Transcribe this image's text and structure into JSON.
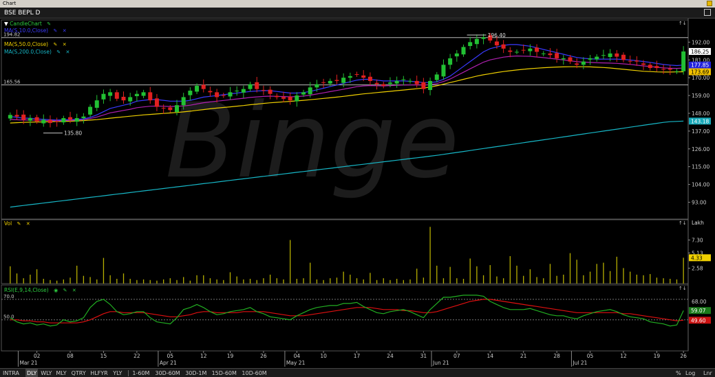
{
  "window": {
    "title": "Chart"
  },
  "symbol": "BSE BEPL D",
  "watermark": "Binge",
  "price_panel": {
    "legends": [
      {
        "label": "CandleChart",
        "color": "#2ecc40"
      },
      {
        "label": "MA(S,10.0,Close)",
        "color": "#3a3aff"
      },
      {
        "label": "MA(S,50.0,Close)",
        "color": "#f0d000"
      },
      {
        "label": "MA(S,200.0,Close)",
        "color": "#17b8c8"
      }
    ],
    "ref_lines": [
      {
        "label": "194.82",
        "value": 194.82
      },
      {
        "label": "165.56",
        "value": 165.56
      }
    ],
    "annotations": [
      {
        "label": "196.40",
        "value": 196.4
      },
      {
        "label": "135.80",
        "value": 135.8
      }
    ],
    "y_ticks": [
      "192.00",
      "181.00",
      "170.00",
      "159.00",
      "148.00",
      "137.00",
      "126.00",
      "115.00",
      "104.00",
      "93.00"
    ],
    "price_badges": [
      {
        "label": "186.25",
        "value": 186.25,
        "bg": "#ffffff",
        "fg": "#000000"
      },
      {
        "label": "177.85",
        "value": 177.85,
        "bg": "#2222dd",
        "fg": "#ffffff"
      },
      {
        "label": "173.69",
        "value": 173.69,
        "bg": "#f0c000",
        "fg": "#000000"
      },
      {
        "label": "143.18",
        "value": 143.18,
        "bg": "#17a8b8",
        "fg": "#ffffff"
      }
    ]
  },
  "vol_panel": {
    "label": "Vol",
    "unit": "Lakh",
    "y_ticks": [
      "7.30",
      "5.13",
      "2.58"
    ],
    "badge": "4.33"
  },
  "rsi_panel": {
    "label": "RSI(E,9,14,Close)",
    "levels": [
      "70.0",
      "50.0"
    ],
    "y_ticks": [
      "68.00"
    ],
    "badges": [
      {
        "label": "59.07",
        "value": 59.07,
        "bg": "#1a7a1a"
      },
      {
        "label": "49.60",
        "value": 49.6,
        "bg": "#cc1111"
      }
    ]
  },
  "x_axis": {
    "day_labels": [
      {
        "t": "02",
        "i": 4
      },
      {
        "t": "08",
        "i": 9
      },
      {
        "t": "15",
        "i": 14
      },
      {
        "t": "22",
        "i": 19
      },
      {
        "t": "05",
        "i": 24
      },
      {
        "t": "12",
        "i": 29
      },
      {
        "t": "19",
        "i": 33
      },
      {
        "t": "26",
        "i": 38
      },
      {
        "t": "04",
        "i": 43
      },
      {
        "t": "10",
        "i": 47
      },
      {
        "t": "17",
        "i": 52
      },
      {
        "t": "24",
        "i": 57
      },
      {
        "t": "31",
        "i": 62
      },
      {
        "t": "07",
        "i": 67
      },
      {
        "t": "14",
        "i": 72
      },
      {
        "t": "21",
        "i": 77
      },
      {
        "t": "28",
        "i": 82
      },
      {
        "t": "05",
        "i": 87
      },
      {
        "t": "12",
        "i": 92
      },
      {
        "t": "19",
        "i": 97
      },
      {
        "t": "26",
        "i": 101
      }
    ],
    "month_labels": [
      {
        "t": "Mar 21",
        "i": 2
      },
      {
        "t": "Apr 21",
        "i": 23
      },
      {
        "t": "May 21",
        "i": 42
      },
      {
        "t": "Jun 21",
        "i": 64
      },
      {
        "t": "Jul 21",
        "i": 85
      }
    ]
  },
  "bottom_bar": {
    "timeframes": [
      "INTRA",
      "DLY",
      "WLY",
      "MLY",
      "QTRY",
      "HLFYR",
      "YLY"
    ],
    "active": "DLY",
    "intraday": [
      "1-60M",
      "30D-60M",
      "30D-1M",
      "15D-60M",
      "10D-60M"
    ],
    "right": [
      "%",
      "Log",
      "Lnr"
    ]
  },
  "chart_data": {
    "type": "candlestick",
    "bars": 102,
    "price_range": [
      86,
      196.4
    ],
    "closes": [
      147,
      146,
      144,
      145,
      143,
      144,
      142,
      143,
      145,
      144,
      145,
      146,
      152,
      156,
      160,
      161,
      157,
      156,
      158,
      160,
      161,
      156,
      152,
      151,
      150,
      153,
      158,
      162,
      165,
      163,
      161,
      158,
      159,
      161,
      162,
      163,
      166,
      163,
      162,
      160,
      158,
      157,
      156,
      159,
      161,
      164,
      166,
      167,
      168,
      168,
      170,
      171,
      172,
      170,
      168,
      166,
      165,
      167,
      168,
      169,
      168,
      166,
      163,
      168,
      172,
      178,
      182,
      185,
      189,
      192,
      194,
      195,
      193,
      190,
      188,
      186,
      186,
      187,
      188,
      186,
      185,
      184,
      182,
      182,
      180,
      178,
      180,
      182,
      183,
      184,
      185,
      183,
      181,
      180,
      180,
      178,
      176,
      176,
      175,
      175,
      174,
      186.25
    ],
    "volume": [
      2.9,
      1.7,
      0.9,
      1.5,
      2.4,
      0.8,
      0.6,
      0.5,
      0.7,
      1.0,
      3.0,
      1.3,
      1.1,
      0.7,
      4.3,
      1.4,
      0.8,
      1.7,
      0.8,
      0.6,
      0.7,
      0.6,
      0.5,
      0.7,
      0.9,
      0.6,
      1.1,
      0.5,
      1.4,
      1.4,
      0.9,
      0.7,
      0.6,
      1.9,
      1.2,
      0.7,
      0.8,
      0.6,
      0.9,
      1.5,
      0.9,
      0.7,
      7.3,
      0.8,
      0.9,
      3.5,
      0.7,
      0.6,
      0.9,
      1.0,
      2.0,
      1.5,
      0.9,
      0.7,
      1.8,
      0.6,
      0.9,
      0.6,
      0.8,
      0.6,
      0.7,
      2.5,
      1.0,
      9.5,
      3.0,
      0.9,
      2.8,
      0.9,
      0.8,
      4.2,
      2.9,
      1.4,
      3.1,
      1.2,
      0.9,
      4.6,
      3.0,
      1.3,
      2.4,
      1.1,
      0.9,
      3.3,
      1.3,
      1.5,
      5.1,
      4.0,
      1.4,
      2.0,
      3.3,
      3.5,
      2.1,
      4.5,
      2.6,
      2.0,
      1.5,
      1.4,
      1.6,
      1.0,
      0.9,
      0.8,
      0.7,
      4.33
    ],
    "rsi": [
      52,
      48,
      46,
      47,
      45,
      46,
      44,
      45,
      50,
      48,
      49,
      52,
      62,
      68,
      70,
      65,
      58,
      55,
      56,
      58,
      58,
      52,
      48,
      47,
      46,
      52,
      60,
      62,
      65,
      62,
      58,
      55,
      56,
      58,
      59,
      60,
      62,
      58,
      56,
      53,
      52,
      51,
      50,
      54,
      57,
      60,
      62,
      63,
      64,
      64,
      66,
      66,
      67,
      63,
      60,
      57,
      56,
      58,
      59,
      60,
      58,
      55,
      52,
      60,
      66,
      72,
      72,
      73,
      74,
      74,
      74,
      73,
      68,
      65,
      62,
      60,
      60,
      60,
      61,
      59,
      57,
      55,
      54,
      54,
      52,
      51,
      54,
      56,
      58,
      59,
      60,
      58,
      55,
      53,
      52,
      51,
      48,
      47,
      46,
      44,
      45,
      59.07
    ],
    "ma10": [
      146,
      145.5,
      145,
      145,
      144.5,
      144.3,
      144,
      143.8,
      144,
      144.1,
      144.2,
      144.5,
      145.5,
      147,
      149,
      151,
      152,
      153,
      154,
      155.5,
      156,
      156.5,
      156.5,
      156,
      155.5,
      155.5,
      155.5,
      156,
      157,
      158,
      158.5,
      159,
      159.5,
      160,
      160.5,
      161,
      161.5,
      161.8,
      162,
      162,
      161.5,
      161,
      160.5,
      160.5,
      160.8,
      161.5,
      162.5,
      163.5,
      164.5,
      165.5,
      166.5,
      167.5,
      168.5,
      169,
      169,
      168.5,
      168,
      168,
      168,
      168,
      167.8,
      167.5,
      167,
      167,
      167.5,
      169,
      171,
      174,
      177,
      180,
      183,
      186,
      188,
      189,
      190,
      190.5,
      190.5,
      190,
      189.5,
      188.5,
      187.5,
      186.5,
      185.5,
      184.5,
      183.5,
      182.5,
      182,
      181.7,
      181.5,
      181.5,
      181.5,
      181.5,
      181.3,
      181,
      180.5,
      180,
      179.5,
      178.8,
      178.2,
      177.8,
      177.5,
      177.85
    ],
    "ma50": [
      142,
      142.2,
      142.4,
      142.5,
      142.6,
      142.7,
      142.8,
      142.9,
      143,
      143.1,
      143.3,
      143.5,
      143.8,
      144.1,
      144.5,
      145,
      145.4,
      145.8,
      146.2,
      146.6,
      147,
      147.3,
      147.6,
      147.9,
      148.2,
      148.5,
      148.9,
      149.3,
      149.8,
      150.3,
      150.8,
      151.2,
      151.6,
      152,
      152.4,
      152.8,
      153.3,
      153.7,
      154.1,
      154.5,
      154.8,
      155.1,
      155.4,
      155.7,
      156,
      156.4,
      156.8,
      157.2,
      157.6,
      158,
      158.5,
      159,
      159.5,
      160,
      160.4,
      160.8,
      161.2,
      161.6,
      162,
      162.4,
      162.8,
      163.2,
      163.6,
      164.2,
      165,
      166,
      167,
      168,
      169,
      170,
      171,
      171.8,
      172.5,
      173.2,
      173.8,
      174.3,
      174.8,
      175.2,
      175.6,
      175.9,
      176.2,
      176.4,
      176.6,
      176.7,
      176.8,
      176.8,
      176.8,
      176.7,
      176.5,
      176.3,
      176,
      175.6,
      175.2,
      174.8,
      174.4,
      174,
      173.8,
      173.6,
      173.5,
      173.5,
      173.6,
      173.69
    ],
    "ma200": [
      90,
      90.5,
      91,
      91.5,
      92,
      92.5,
      93,
      93.5,
      94,
      94.5,
      95,
      95.5,
      96,
      96.5,
      97,
      97.5,
      98,
      98.5,
      99,
      99.5,
      100,
      100.5,
      101,
      101.5,
      102,
      102.5,
      103,
      103.5,
      104,
      104.5,
      105,
      105.5,
      106,
      106.5,
      107,
      107.5,
      108,
      108.5,
      109,
      109.5,
      110,
      110.5,
      111,
      111.5,
      112,
      112.5,
      113,
      113.5,
      114,
      114.5,
      115,
      115.5,
      116,
      116.5,
      117,
      117.5,
      118,
      118.5,
      119,
      119.5,
      120,
      120.5,
      121,
      121.5,
      122,
      122.6,
      123.2,
      123.8,
      124.4,
      125,
      125.6,
      126.2,
      126.8,
      127.4,
      128,
      128.6,
      129.2,
      129.8,
      130.4,
      131,
      131.6,
      132.2,
      132.8,
      133.4,
      134,
      134.6,
      135.2,
      135.8,
      136.4,
      137,
      137.6,
      138.2,
      138.8,
      139.4,
      140,
      140.6,
      141.2,
      141.8,
      142.4,
      142.8,
      143,
      143.18
    ],
    "rsi_signal": [
      50,
      50,
      49,
      49,
      48,
      48,
      47,
      47,
      47,
      47,
      47,
      48,
      50,
      53,
      56,
      58,
      58,
      57,
      57,
      57,
      57,
      56,
      55,
      54,
      53,
      53,
      54,
      55,
      57,
      58,
      58,
      57,
      57,
      57,
      57,
      58,
      58,
      58,
      58,
      57,
      56,
      55,
      54,
      54,
      54,
      55,
      56,
      57,
      58,
      59,
      60,
      61,
      62,
      62,
      62,
      61,
      60,
      60,
      60,
      59,
      59,
      58,
      57,
      57,
      58,
      60,
      62,
      64,
      66,
      68,
      69,
      70,
      70,
      69,
      68,
      67,
      66,
      65,
      64,
      63,
      62,
      61,
      60,
      59,
      58,
      57,
      57,
      57,
      57,
      57,
      57,
      57,
      56,
      56,
      55,
      54,
      53,
      52,
      51,
      50,
      49,
      49.6
    ]
  }
}
